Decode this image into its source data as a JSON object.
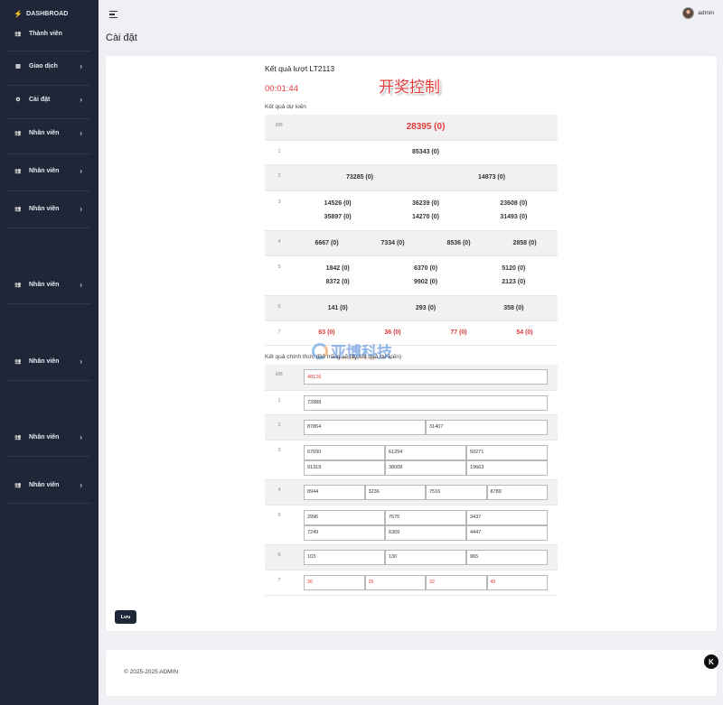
{
  "sidebar": {
    "brand": "DASHBROAD",
    "items": [
      {
        "label": "Thành viên",
        "icon": "users-icon",
        "chevron": false
      },
      {
        "label": "Giao dịch",
        "icon": "receipt-icon",
        "chevron": true
      },
      {
        "label": "Cài đặt",
        "icon": "gear-icon",
        "chevron": true
      },
      {
        "label": "Nhân viên",
        "icon": "users-icon",
        "chevron": true
      },
      {
        "label": "Nhân viên",
        "icon": "users-icon",
        "chevron": true
      },
      {
        "label": "Nhân viên",
        "icon": "users-icon",
        "chevron": true
      },
      {
        "label": "Nhân viên",
        "icon": "users-icon",
        "chevron": true
      },
      {
        "label": "Nhân viên",
        "icon": "users-icon",
        "chevron": true
      },
      {
        "label": "Nhân viên",
        "icon": "users-icon",
        "chevron": true
      },
      {
        "label": "Nhân viên",
        "icon": "users-icon",
        "chevron": true
      }
    ]
  },
  "topbar": {
    "username": "admin"
  },
  "page": {
    "title": "Cài đặt"
  },
  "round": {
    "title": "Kết quả lượt LT2113",
    "timer": "00:01:44",
    "watermark": "开奖控制"
  },
  "expected": {
    "label": "Kết quả dự kiến",
    "rows": [
      {
        "label": "ĐB",
        "values": [
          "28395 (0)"
        ]
      },
      {
        "label": "1",
        "values": [
          "85343 (0)"
        ]
      },
      {
        "label": "2",
        "values": [
          "73285 (0)",
          "14873 (0)"
        ]
      },
      {
        "label": "3",
        "values": [
          "14526 (0)",
          "36239 (0)",
          "23608 (0)",
          "35897 (0)",
          "14270 (0)",
          "31493 (0)"
        ]
      },
      {
        "label": "4",
        "values": [
          "6667 (0)",
          "7334 (0)",
          "8536 (0)",
          "2858 (0)"
        ]
      },
      {
        "label": "5",
        "values": [
          "1842 (0)",
          "6370 (0)",
          "5120 (0)",
          "8372 (0)",
          "9902 (0)",
          "2123 (0)"
        ]
      },
      {
        "label": "6",
        "values": [
          "141 (0)",
          "293 (0)",
          "358 (0)"
        ]
      },
      {
        "label": "7",
        "values": [
          "63 (0)",
          "36 (0)",
          "77 (0)",
          "54 (0)"
        ]
      }
    ]
  },
  "official": {
    "label": "Kết quả chính thức (Bỏ trống sẽ lấy kết quả dự kiến)",
    "rows": [
      {
        "label": "ĐB",
        "values": [
          "48126"
        ]
      },
      {
        "label": "1",
        "values": [
          "72888"
        ]
      },
      {
        "label": "2",
        "values": [
          "87864",
          "31407"
        ]
      },
      {
        "label": "3",
        "values": [
          "67690",
          "61294",
          "50271",
          "91319",
          "38008",
          "19663"
        ]
      },
      {
        "label": "4",
        "values": [
          "8944",
          "3236",
          "7516",
          "8789"
        ]
      },
      {
        "label": "5",
        "values": [
          "2996",
          "7675",
          "3437",
          "7249",
          "6369",
          "4447"
        ]
      },
      {
        "label": "6",
        "values": [
          "103",
          "130",
          "965"
        ]
      },
      {
        "label": "7",
        "values": [
          "26",
          "25",
          "32",
          "45"
        ]
      }
    ]
  },
  "watermark_logo": {
    "text": "亚博科技",
    "sub": "YABOKEJI.COM"
  },
  "save_label": "Lưu",
  "footer": {
    "text": "© 2025-2025 ADMIN"
  },
  "float_button": "K",
  "colors": {
    "sidebar": "#1e2637",
    "accent_red": "#e03a3a",
    "row_alt": "#f1f1f1"
  }
}
